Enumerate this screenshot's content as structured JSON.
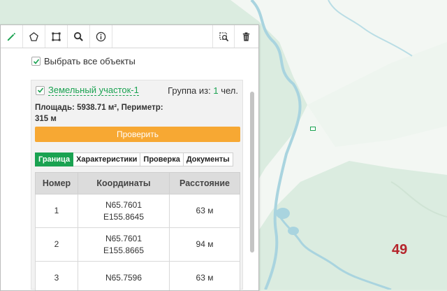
{
  "toolbar": {
    "items": [
      {
        "icon": "pencil-icon",
        "active": true
      },
      {
        "icon": "polygon-icon"
      },
      {
        "icon": "square-icon"
      },
      {
        "icon": "search-icon"
      },
      {
        "icon": "info-icon"
      },
      {
        "icon": "zoom-area-icon"
      },
      {
        "icon": "trash-icon"
      }
    ]
  },
  "select_all": {
    "label": "Выбрать все объекты",
    "checked": true
  },
  "parcel": {
    "name": "Земельный участок-1",
    "group_prefix": "Группа из:",
    "group_count": "1",
    "group_suffix": "чел.",
    "area_line1": "Площадь: 5938.71 м², Периметр:",
    "area_line2": "315 м",
    "check_button": "Проверить"
  },
  "tabs": [
    "Граница",
    "Характеристики",
    "Проверка",
    "Документы"
  ],
  "table": {
    "headers": [
      "Номер",
      "Координаты",
      "Расстояние"
    ],
    "rows": [
      {
        "num": "1",
        "coord1": "N65.7601",
        "coord2": "E155.8645",
        "dist": "63 м"
      },
      {
        "num": "2",
        "coord1": "N65.7601",
        "coord2": "E155.8665",
        "dist": "94 м"
      },
      {
        "num": "3",
        "coord1": "N65.7596",
        "coord2": "",
        "dist": "63 м"
      }
    ]
  },
  "map": {
    "region_label": "49"
  },
  "colors": {
    "accent": "#1aa251",
    "button": "#f7a833",
    "map_bg": "#dfeee3",
    "river": "#b9dde5"
  }
}
